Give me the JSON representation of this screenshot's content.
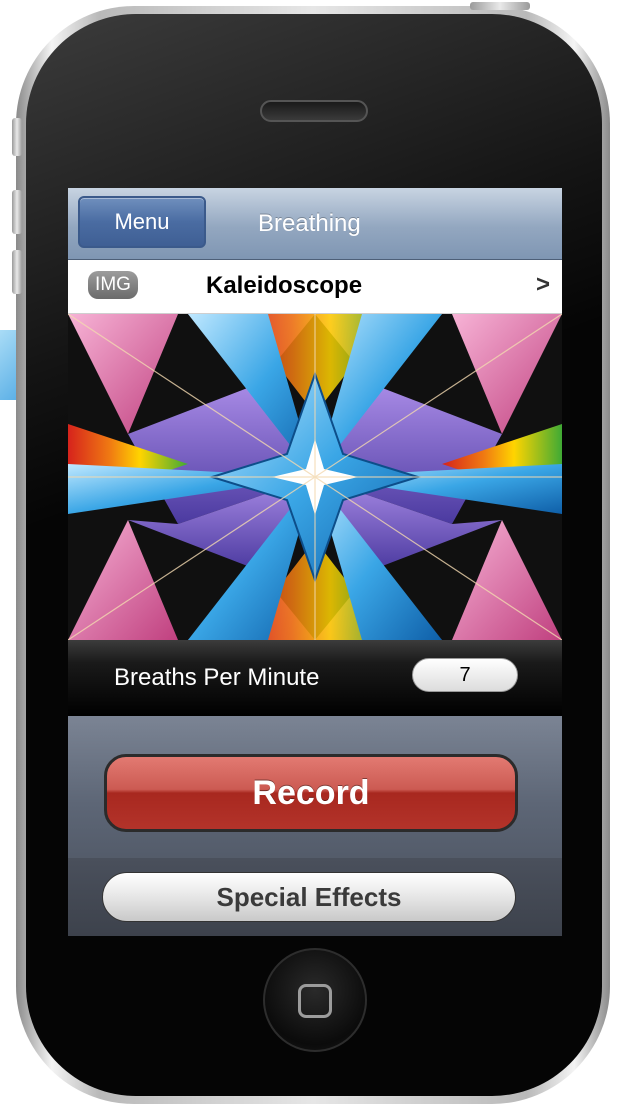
{
  "nav": {
    "menu_label": "Menu",
    "title": "Breathing"
  },
  "cell": {
    "badge": "IMG",
    "title": "Kaleidoscope",
    "chevron": ">"
  },
  "bpm": {
    "label": "Breaths Per Minute",
    "value": "7"
  },
  "actions": {
    "record_label": "Record",
    "effects_label": "Special Effects"
  },
  "colors": {
    "nav_bar": "#93a7c0",
    "menu_button": "#4a6ca2",
    "record_button": "#b3332a",
    "controls_panel": "#5d6676"
  },
  "icons": {
    "cell_arrow": "chevron-right-icon",
    "home": "home-button-icon",
    "pointer": "callout-arrow-icon"
  }
}
